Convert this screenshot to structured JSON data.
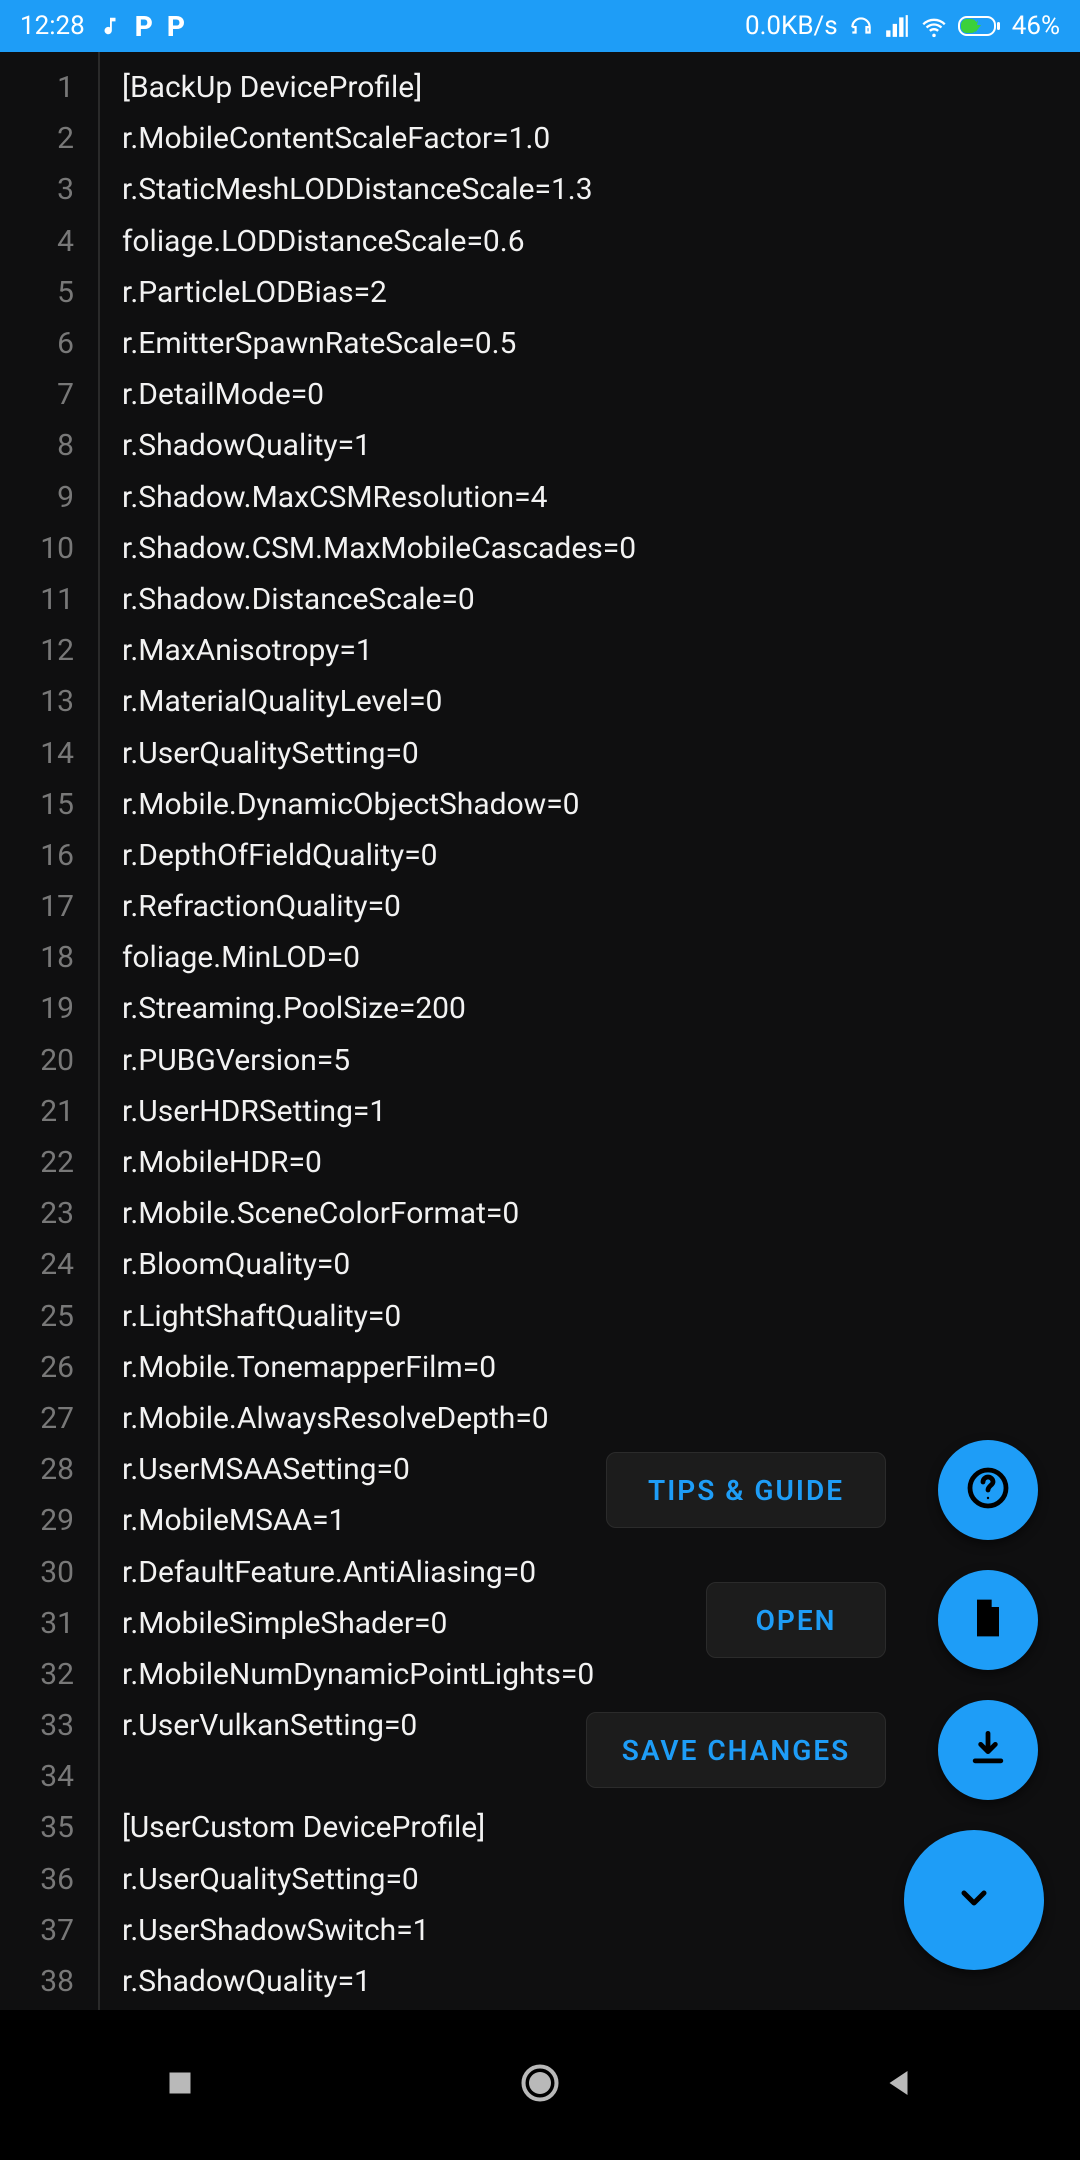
{
  "status_bar": {
    "time": "12:28",
    "net_speed": "0.0KB/s",
    "battery": "46%",
    "icons_left": [
      "music-note-icon",
      "letter-p-icon",
      "letter-p-icon"
    ],
    "icons_right": [
      "headphones-icon",
      "signal-icon",
      "wifi-icon",
      "battery-charging-icon"
    ]
  },
  "editor": {
    "lines": [
      "[BackUp DeviceProfile]",
      "r.MobileContentScaleFactor=1.0",
      "r.StaticMeshLODDistanceScale=1.3",
      "foliage.LODDistanceScale=0.6",
      "r.ParticleLODBias=2",
      "r.EmitterSpawnRateScale=0.5",
      "r.DetailMode=0",
      "r.ShadowQuality=1",
      "r.Shadow.MaxCSMResolution=4",
      "r.Shadow.CSM.MaxMobileCascades=0",
      "r.Shadow.DistanceScale=0",
      "r.MaxAnisotropy=1",
      "r.MaterialQualityLevel=0",
      "r.UserQualitySetting=0",
      "r.Mobile.DynamicObjectShadow=0",
      "r.DepthOfFieldQuality=0",
      "r.RefractionQuality=0",
      "foliage.MinLOD=0",
      "r.Streaming.PoolSize=200",
      "r.PUBGVersion=5",
      "r.UserHDRSetting=1",
      "r.MobileHDR=0",
      "r.Mobile.SceneColorFormat=0",
      "r.BloomQuality=0",
      "r.LightShaftQuality=0",
      "r.Mobile.TonemapperFilm=0",
      "r.Mobile.AlwaysResolveDepth=0",
      "r.UserMSAASetting=0",
      "r.MobileMSAA=1",
      "r.DefaultFeature.AntiAliasing=0",
      "r.MobileSimpleShader=0",
      "r.MobileNumDynamicPointLights=0",
      "r.UserVulkanSetting=0",
      "",
      "[UserCustom DeviceProfile]",
      "r.UserQualitySetting=0",
      "r.UserShadowSwitch=1",
      "r.ShadowQuality=1"
    ]
  },
  "buttons": {
    "tips_guide": "TIPS & GUIDE",
    "open": "OPEN",
    "save": "SAVE CHANGES"
  },
  "fab_icons": {
    "help": "help-circle-icon",
    "file": "file-icon",
    "save": "download-icon",
    "expand": "chevron-down-icon"
  },
  "nav": {
    "recent": "recent-apps-icon",
    "home": "home-icon",
    "back": "back-icon"
  },
  "colors": {
    "accent": "#1e9df7",
    "bg": "#0f0f10",
    "text": "#f2f2f2",
    "gutter_text": "#787878"
  }
}
